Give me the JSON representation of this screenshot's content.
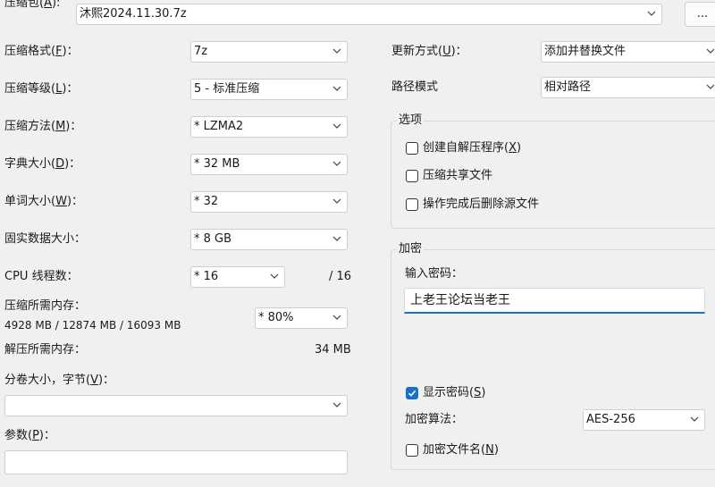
{
  "archive": {
    "label_prefix": "压缩包(",
    "label_key": "A",
    "label_suffix": "):",
    "path_value": "沐熙2024.11.30.7z",
    "browse_label": "..."
  },
  "left": {
    "format": {
      "label": "压缩格式(",
      "key": "F",
      "suffix": ")：",
      "value": "7z"
    },
    "level": {
      "label": "压缩等级(",
      "key": "L",
      "suffix": ")：",
      "value": "5 - 标准压缩"
    },
    "method": {
      "label": "压缩方法(",
      "key": "M",
      "suffix": ")：",
      "value": "*  LZMA2"
    },
    "dict": {
      "label": "字典大小(",
      "key": "D",
      "suffix": ")：",
      "value": "*  32 MB"
    },
    "word": {
      "label": "单词大小(",
      "key": "W",
      "suffix": ")：",
      "value": "*  32"
    },
    "solid": {
      "label": "固实数据大小：",
      "value": "*  8 GB"
    },
    "threads": {
      "label": "CPU 线程数：",
      "value": "*  16",
      "max": "/ 16"
    },
    "mem_compress": {
      "label": "压缩所需内存：",
      "detail": "4928 MB / 12874 MB / 16093 MB",
      "value": "*  80%"
    },
    "mem_decompress": {
      "label": "解压所需内存：",
      "value": "34 MB"
    },
    "volume": {
      "label": "分卷大小，字节(",
      "key": "V",
      "suffix": ")：",
      "value": ""
    },
    "params": {
      "label": "参数(",
      "key": "P",
      "suffix": ")：",
      "value": ""
    }
  },
  "right": {
    "update": {
      "label": "更新方式(",
      "key": "U",
      "suffix": ")：",
      "value": "添加并替换文件"
    },
    "path_mode": {
      "label": "路径模式",
      "value": "相对路径"
    },
    "options": {
      "title": "选项",
      "sfx": {
        "label": "创建自解压程序(",
        "key": "X",
        "suffix": ")"
      },
      "shared": {
        "label": "压缩共享文件"
      },
      "delete": {
        "label": "操作完成后删除源文件"
      }
    },
    "encryption": {
      "title": "加密",
      "password_label": "输入密码：",
      "password_value": "上老王论坛当老王",
      "show_pwd": {
        "label": "显示密码(",
        "key": "S",
        "suffix": ")",
        "checked": true
      },
      "method_label": "加密算法：",
      "method_value": "AES-256",
      "encrypt_names": {
        "label": "加密文件名(",
        "key": "N",
        "suffix": ")"
      }
    }
  },
  "colors": {
    "accent": "#1a6fc9",
    "focus_underline": "#1a6fc9"
  }
}
